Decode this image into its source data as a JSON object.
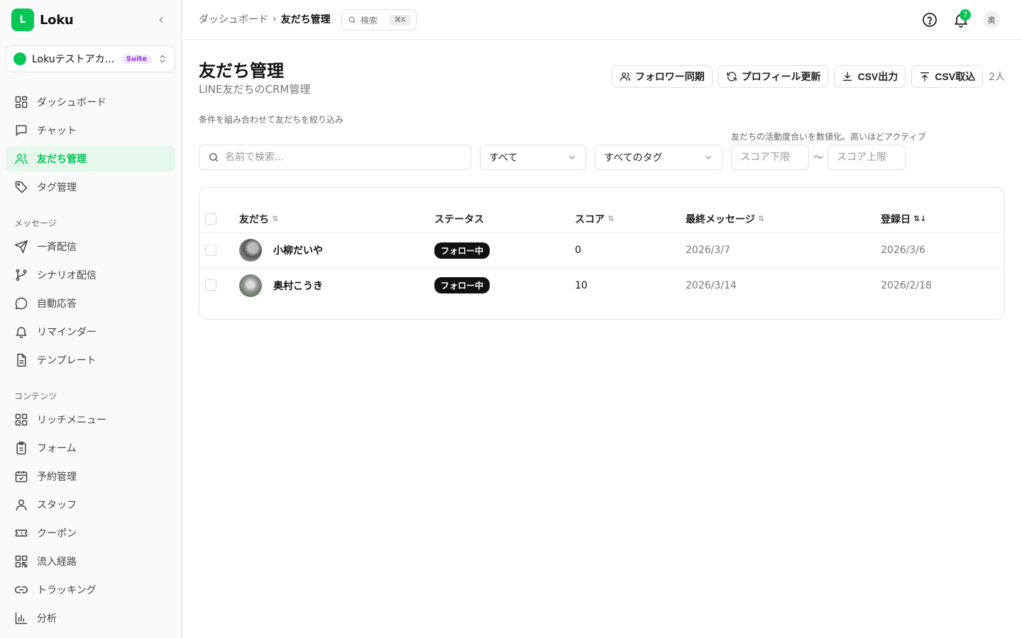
{
  "brand": {
    "logo_letter": "L",
    "name": "Loku"
  },
  "account": {
    "name": "Lokuテストアカ...",
    "badge": "Suite"
  },
  "nav": {
    "main": [
      {
        "label": "ダッシュボード",
        "icon": "grid-icon"
      },
      {
        "label": "チャット",
        "icon": "chat-icon"
      },
      {
        "label": "友だち管理",
        "icon": "users-icon",
        "active": true
      },
      {
        "label": "タグ管理",
        "icon": "tag-icon"
      }
    ],
    "section_message": "メッセージ",
    "message": [
      {
        "label": "一斉配信",
        "icon": "send-icon"
      },
      {
        "label": "シナリオ配信",
        "icon": "branch-icon"
      },
      {
        "label": "自動応答",
        "icon": "message-circle-icon"
      },
      {
        "label": "リマインダー",
        "icon": "bell-icon"
      },
      {
        "label": "テンプレート",
        "icon": "file-text-icon"
      }
    ],
    "section_content": "コンテンツ",
    "content": [
      {
        "label": "リッチメニュー",
        "icon": "grid-icon"
      },
      {
        "label": "フォーム",
        "icon": "clipboard-icon"
      },
      {
        "label": "予約管理",
        "icon": "calendar-check-icon"
      },
      {
        "label": "スタッフ",
        "icon": "user-icon"
      },
      {
        "label": "クーポン",
        "icon": "ticket-icon"
      },
      {
        "label": "流入経路",
        "icon": "qr-icon"
      },
      {
        "label": "トラッキング",
        "icon": "link-icon"
      },
      {
        "label": "分析",
        "icon": "bar-chart-icon"
      }
    ]
  },
  "header": {
    "breadcrumb_root": "ダッシュボード",
    "breadcrumb_sep": "›",
    "breadcrumb_current": "友だち管理",
    "search_label": "検索",
    "search_kbd": "⌘K",
    "notification_count": "7",
    "user_initial": "奥"
  },
  "page": {
    "title": "友だち管理",
    "subtitle": "LINE友だちのCRM管理",
    "actions": {
      "sync": "フォロワー同期",
      "refresh": "プロフィール更新",
      "export": "CSV出力",
      "import": "CSV取込"
    },
    "count": "2人"
  },
  "filters": {
    "hint": "条件を組み合わせて友だちを絞り込み",
    "score_hint": "友だちの活動度合いを数値化。高いほどアクティブ",
    "search_placeholder": "名前で検索...",
    "status_value": "すべて",
    "tag_value": "すべてのタグ",
    "score_min_placeholder": "スコア下限",
    "score_sep": "〜",
    "score_max_placeholder": "スコア上限"
  },
  "table": {
    "columns": {
      "friend": "友だち",
      "status": "ステータス",
      "score": "スコア",
      "last_message": "最終メッセージ",
      "registered": "登録日"
    },
    "rows": [
      {
        "name": "小柳だいや",
        "status": "フォロー中",
        "score": "0",
        "last_message": "2026/3/7",
        "registered": "2026/3/6"
      },
      {
        "name": "奥村こうき",
        "status": "フォロー中",
        "score": "10",
        "last_message": "2026/3/14",
        "registered": "2026/2/18"
      }
    ]
  },
  "colors": {
    "accent": "#06c755",
    "active_bg": "#e6f7ec",
    "suite_badge": "#9333ea"
  }
}
